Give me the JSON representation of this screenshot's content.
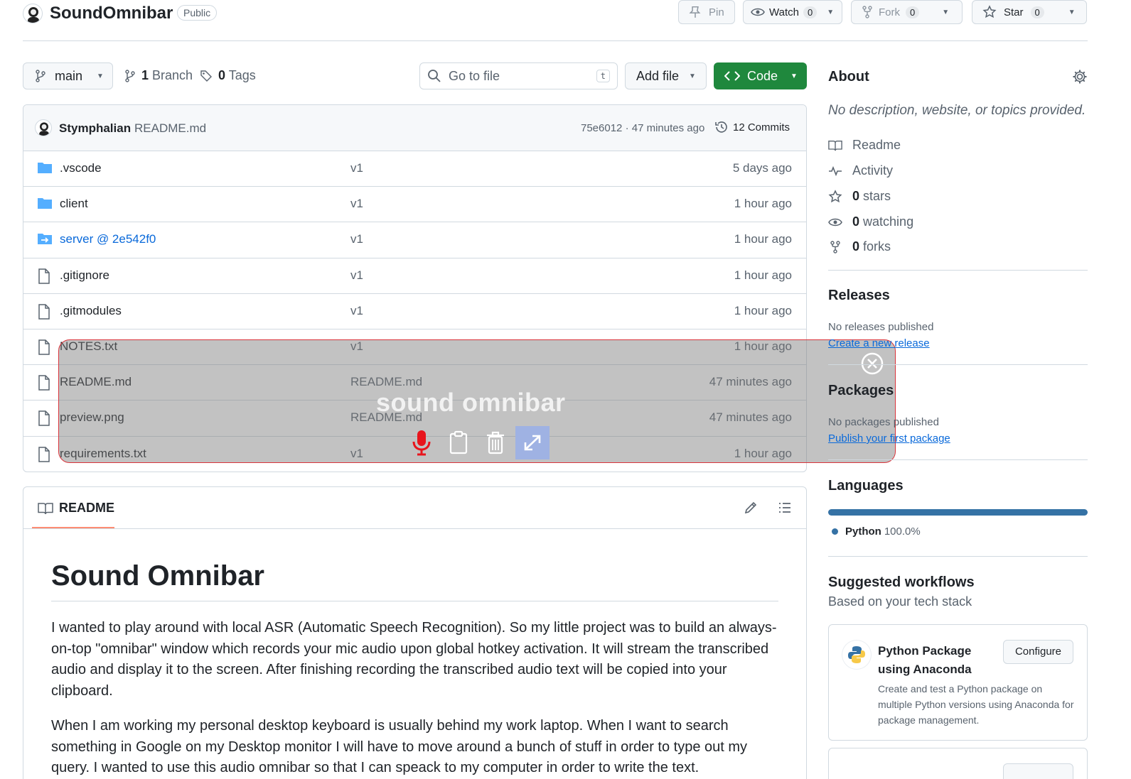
{
  "repo": {
    "name": "SoundOmnibar",
    "visibility": "Public",
    "pin_label": "Pin",
    "watch_label": "Watch",
    "watch_count": "0",
    "fork_label": "Fork",
    "fork_count": "0",
    "star_label": "Star",
    "star_count": "0"
  },
  "toolbar": {
    "branch": "main",
    "branch_count": "1",
    "branch_label": "Branch",
    "tag_count": "0",
    "tag_label": "Tags",
    "search_placeholder": "Go to file",
    "search_shortcut": "t",
    "add_file": "Add file",
    "code": "Code"
  },
  "commit": {
    "author": "Stymphalian",
    "message": "README.md",
    "hash_time": "75e6012 · 47 minutes ago",
    "commits": "12 Commits"
  },
  "files": [
    {
      "name": ".vscode",
      "type": "folder",
      "message": "v1",
      "date": "5 days ago"
    },
    {
      "name": "client",
      "type": "folder",
      "message": "v1",
      "date": "1 hour ago"
    },
    {
      "name": "server @ 2e542f0",
      "type": "submodule",
      "message": "v1",
      "date": "1 hour ago"
    },
    {
      "name": ".gitignore",
      "type": "file",
      "message": "v1",
      "date": "1 hour ago"
    },
    {
      "name": ".gitmodules",
      "type": "file",
      "message": "v1",
      "date": "1 hour ago"
    },
    {
      "name": "NOTES.txt",
      "type": "file",
      "message": "v1",
      "date": "1 hour ago"
    },
    {
      "name": "README.md",
      "type": "file",
      "message": "README.md",
      "date": "47 minutes ago"
    },
    {
      "name": "preview.png",
      "type": "file",
      "message": "README.md",
      "date": "47 minutes ago"
    },
    {
      "name": "requirements.txt",
      "type": "file",
      "message": "v1",
      "date": "1 hour ago"
    }
  ],
  "overlay": {
    "title": "sound omnibar",
    "icons": [
      "microphone-icon",
      "clipboard-icon",
      "trash-icon",
      "expand-icon",
      "close-icon"
    ],
    "mic_color": "#e8141c",
    "border_color": "#d9343b"
  },
  "readme": {
    "tab": "README",
    "title": "Sound Omnibar",
    "p1": "I wanted to play around with local ASR (Automatic Speech Recognition). So my little project was to build an always-on-top \"omnibar\" window which records your mic audio upon global hotkey activation. It will stream the transcribed audio and display it to the screen. After finishing recording the transcribed audio text will be copied into your clipboard.",
    "p2": "When I am working my personal desktop keyboard is usually behind my work laptop. When I want to search something in Google on my Desktop monitor I will have to move around a bunch of stuff in order to type out my query. I wanted to use this audio omnibar so that I can speack to my computer in order to write the text."
  },
  "sidebar": {
    "about_title": "About",
    "about_desc": "No description, website, or topics provided.",
    "readme": "Readme",
    "activity": "Activity",
    "stars_count": "0",
    "stars_label": "stars",
    "watching_count": "0",
    "watching_label": "watching",
    "forks_count": "0",
    "forks_label": "forks",
    "releases_title": "Releases",
    "releases_none": "No releases published",
    "releases_link": "Create a new release",
    "packages_title": "Packages",
    "packages_none": "No packages published",
    "packages_link": "Publish your first package",
    "languages_title": "Languages",
    "language_name": "Python",
    "language_pct": "100.0%",
    "language_color": "#3572A5",
    "workflows_title": "Suggested workflows",
    "workflows_sub": "Based on your tech stack",
    "workflow_name": "Python Package using Anaconda",
    "workflow_configure": "Configure",
    "workflow_desc": "Create and test a Python package on multiple Python versions using Anaconda for package management."
  }
}
